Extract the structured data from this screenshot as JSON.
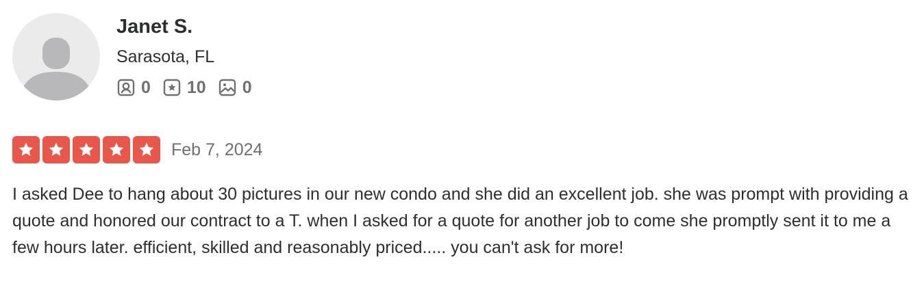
{
  "reviewer": {
    "name": "Janet S.",
    "location": "Sarasota, FL",
    "avatar_icon": "default-user-avatar-icon",
    "stats": {
      "friends": "0",
      "reviews": "10",
      "photos": "0"
    }
  },
  "review": {
    "rating": 5,
    "max_rating": 5,
    "date": "Feb 7, 2024",
    "text": "I asked Dee to hang about 30 pictures in our new condo and she did an excellent job. she was prompt with providing a quote and honored our contract to a T. when I asked for a quote for another job to come she promptly sent it to me a few hours later. efficient, skilled and reasonably priced..... you can't ask for more!"
  },
  "colors": {
    "star_active": "#e9574b",
    "star_inactive": "#e0e0e0",
    "text_primary": "#2d2e2f",
    "text_secondary": "#6e7072",
    "avatar_bg": "#ebebeb",
    "avatar_figure": "#b8b8ba"
  },
  "icons": {
    "friends": "friends-icon",
    "reviews": "reviews-star-icon",
    "photos": "photos-icon",
    "star": "star-icon"
  }
}
